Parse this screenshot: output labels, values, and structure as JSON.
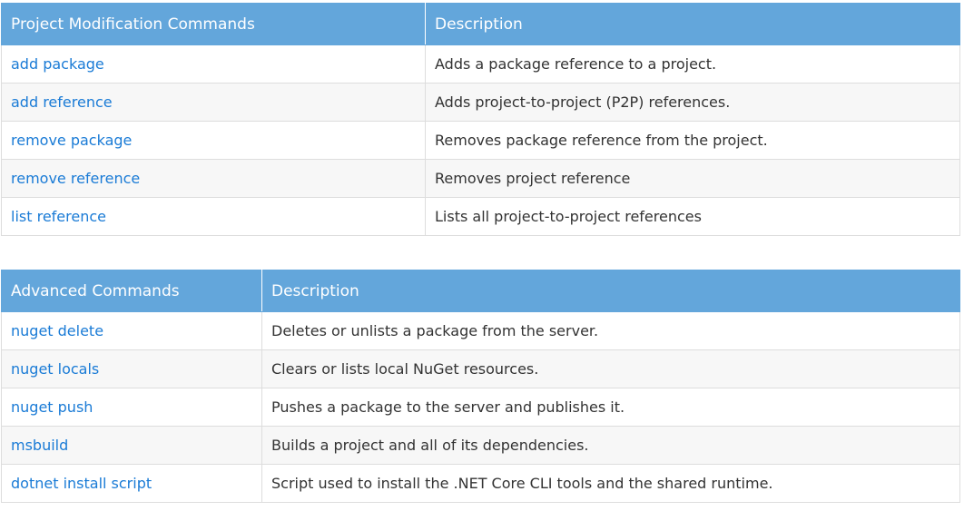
{
  "project_table": {
    "headers": [
      "Project Modification Commands",
      "Description"
    ],
    "rows": [
      {
        "command": "add package",
        "description": "Adds a package reference to a project."
      },
      {
        "command": "add reference",
        "description": "Adds project-to-project (P2P) references."
      },
      {
        "command": "remove package",
        "description": "Removes package reference from the project."
      },
      {
        "command": "remove reference",
        "description": "Removes project reference"
      },
      {
        "command": "list reference",
        "description": "Lists all project-to-project references"
      }
    ]
  },
  "advanced_table": {
    "headers": [
      "Advanced Commands",
      "Description"
    ],
    "rows": [
      {
        "command": "nuget delete",
        "description": "Deletes or unlists a package from the server."
      },
      {
        "command": "nuget locals",
        "description": "Clears or lists local NuGet resources."
      },
      {
        "command": "nuget push",
        "description": "Pushes a package to the server and publishes it."
      },
      {
        "command": "msbuild",
        "description": "Builds a project and all of its dependencies."
      },
      {
        "command": "dotnet install script",
        "description": "Script used to install the .NET Core CLI tools and the shared runtime."
      }
    ]
  },
  "colors": {
    "header_bg": "#63a6db",
    "header_text": "#ffffff",
    "link": "#1a7bd6",
    "stripe": "#f7f7f7"
  }
}
